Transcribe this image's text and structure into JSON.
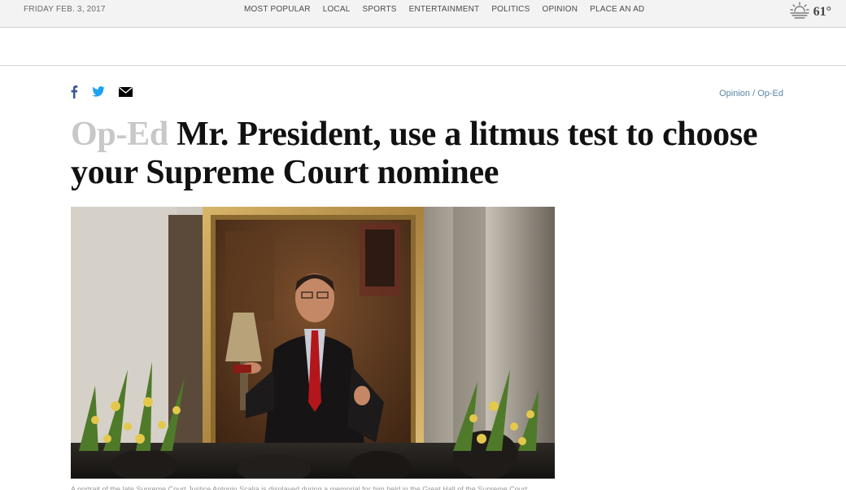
{
  "topbar": {
    "date": "FRIDAY FEB. 3, 2017",
    "nav": [
      "MOST POPULAR",
      "LOCAL",
      "SPORTS",
      "ENTERTAINMENT",
      "POLITICS",
      "OPINION",
      "PLACE AN AD"
    ],
    "weather": {
      "icon": "sun-rising-icon",
      "temperature": "61°"
    }
  },
  "share": {
    "icons": [
      "facebook-icon",
      "twitter-icon",
      "email-icon"
    ]
  },
  "breadcrumb": {
    "section": "Opinion",
    "separator": "/",
    "current": "Op-Ed"
  },
  "article": {
    "kicker": "Op-Ed",
    "title": "Mr. President, use a litmus test to choose your Supreme Court nominee",
    "caption": "A portrait of the late Supreme Court Justice Antonin Scalia is displayed during a memorial for him held in the Great Hall of the Supreme Court."
  },
  "colors": {
    "kicker": "#c8c8c8",
    "link": "#5a86a7",
    "facebook": "#3b5998",
    "twitter": "#1da1f2"
  }
}
